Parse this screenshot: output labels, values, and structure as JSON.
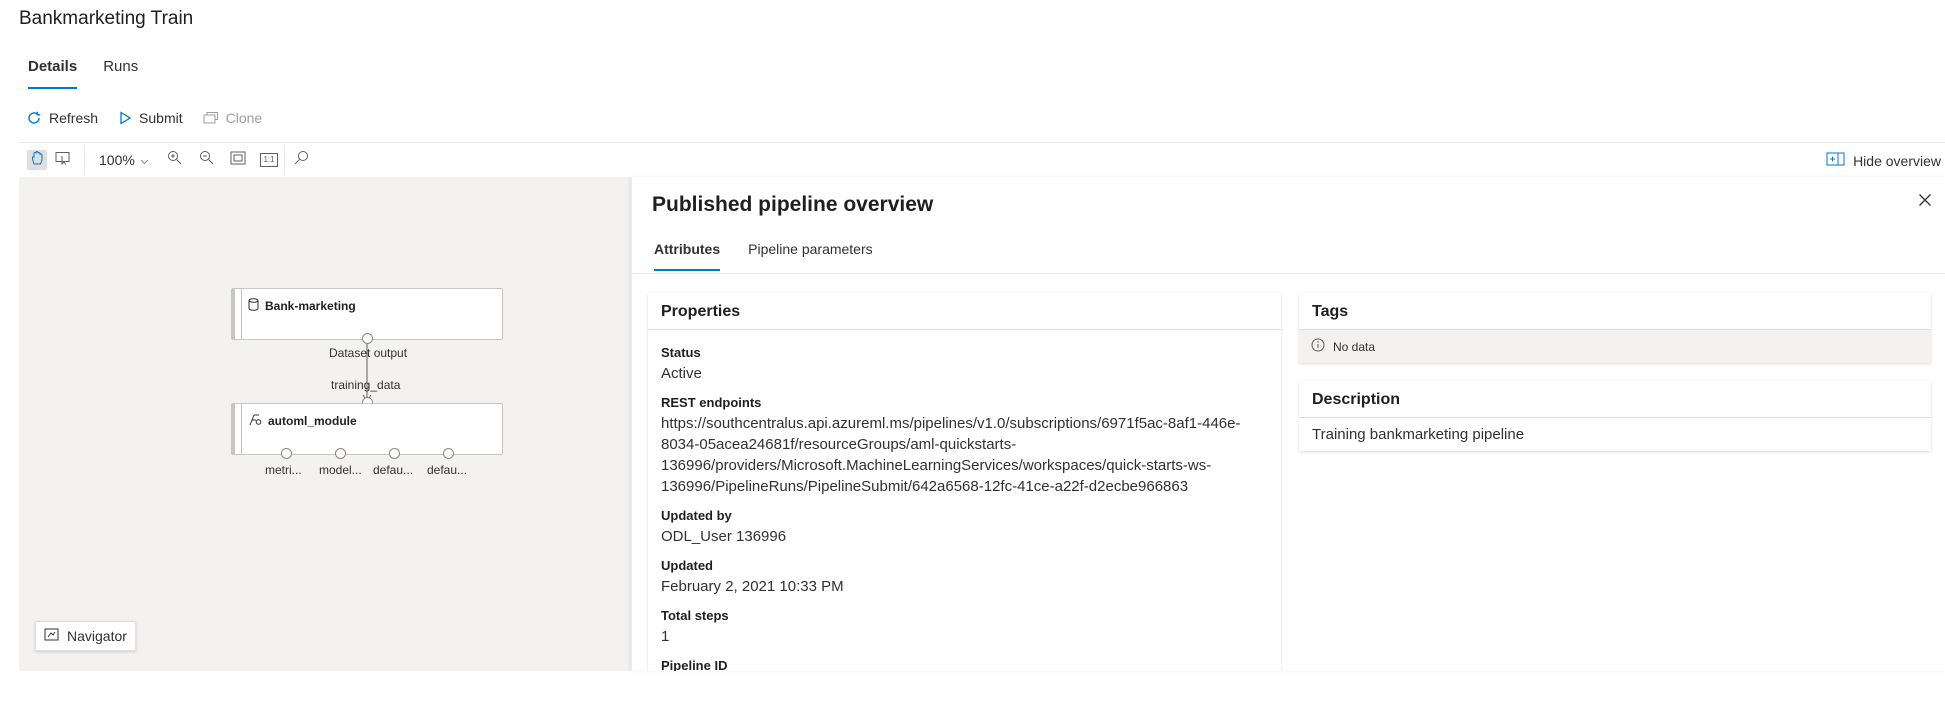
{
  "page": {
    "title": "Bankmarketing Train"
  },
  "tabs": [
    {
      "label": "Details",
      "active": true
    },
    {
      "label": "Runs",
      "active": false
    }
  ],
  "actions": {
    "refresh": "Refresh",
    "submit": "Submit",
    "clone": "Clone"
  },
  "toolbar": {
    "zoom": "100%",
    "hide_overview": "Hide overview",
    "actual_size_glyph": "1:1"
  },
  "graph": {
    "dataset_node": {
      "label": "Bank-marketing",
      "output_label": "Dataset output"
    },
    "edge_label": "training_data",
    "module_node": {
      "label": "automl_module"
    },
    "output_ports": [
      "metri...",
      "model...",
      "defau...",
      "defau..."
    ]
  },
  "navigator": {
    "label": "Navigator"
  },
  "overview": {
    "title": "Published pipeline overview",
    "tabs": [
      {
        "label": "Attributes",
        "active": true
      },
      {
        "label": "Pipeline parameters",
        "active": false
      }
    ],
    "properties": {
      "heading": "Properties",
      "status_label": "Status",
      "status_value": "Active",
      "rest_label": "REST endpoints",
      "rest_value": "https://southcentralus.api.azureml.ms/pipelines/v1.0/subscriptions/6971f5ac-8af1-446e-8034-05acea24681f/resourceGroups/aml-quickstarts-136996/providers/Microsoft.MachineLearningServices/workspaces/quick-starts-ws-136996/PipelineRuns/PipelineSubmit/642a6568-12fc-41ce-a22f-d2ecbe966863",
      "updated_by_label": "Updated by",
      "updated_by_value": "ODL_User 136996",
      "updated_label": "Updated",
      "updated_value": "February 2, 2021 10:33 PM",
      "total_steps_label": "Total steps",
      "total_steps_value": "1",
      "pipeline_id_label": "Pipeline ID"
    },
    "tags": {
      "heading": "Tags",
      "empty": "No data"
    },
    "description": {
      "heading": "Description",
      "text": "Training bankmarketing pipeline"
    }
  },
  "colors": {
    "accent": "#0078d4",
    "canvas_bg": "#f3f2f1"
  }
}
